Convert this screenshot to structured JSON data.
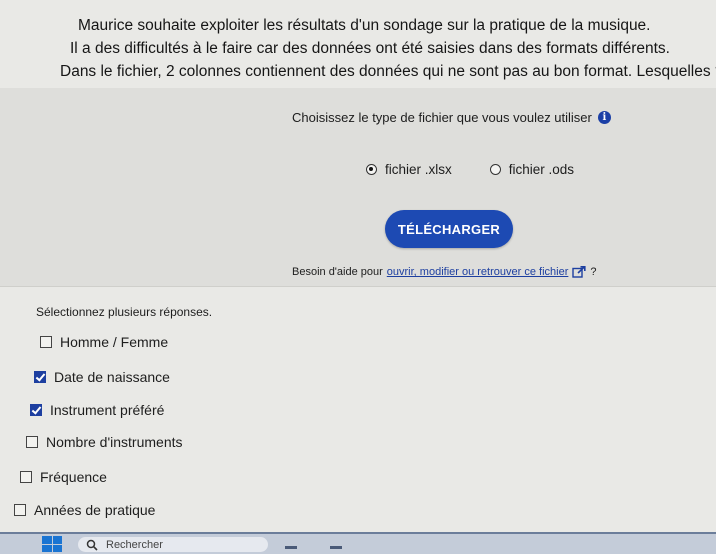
{
  "question": {
    "line1": "Maurice souhaite exploiter les résultats d'un sondage sur la pratique de la musique.",
    "line2": "Il a des difficultés à le faire car des données ont été saisies dans des formats différents.",
    "line3": "Dans le fichier, 2 colonnes contiennent des données qui ne sont pas au bon format. Lesquelles ?"
  },
  "download": {
    "title": "Choisissez le type de fichier que vous voulez utiliser",
    "info_icon_glyph": "i",
    "options": [
      {
        "label": "fichier .xlsx",
        "selected": true
      },
      {
        "label": "fichier .ods",
        "selected": false
      }
    ],
    "button_label": "TÉLÉCHARGER",
    "help_prefix": "Besoin d'aide pour",
    "help_link": "ouvrir, modifier ou retrouver ce fichier",
    "help_suffix": "?"
  },
  "answers": {
    "hint": "Sélectionnez plusieurs réponses.",
    "choices": [
      {
        "label": "Homme / Femme",
        "checked": false
      },
      {
        "label": "Date de naissance",
        "checked": true
      },
      {
        "label": "Instrument préféré",
        "checked": true
      },
      {
        "label": "Nombre d'instruments",
        "checked": false
      },
      {
        "label": "Fréquence",
        "checked": false
      },
      {
        "label": "Années de pratique",
        "checked": false
      }
    ]
  },
  "taskbar": {
    "search_placeholder": "Rechercher"
  },
  "colors": {
    "accent": "#1d4ab3",
    "link": "#1d3fa0",
    "panel": "#dededb"
  },
  "icons": {
    "info": "info-icon",
    "external": "external-link-icon",
    "search": "search-icon",
    "start": "windows-start-icon"
  }
}
